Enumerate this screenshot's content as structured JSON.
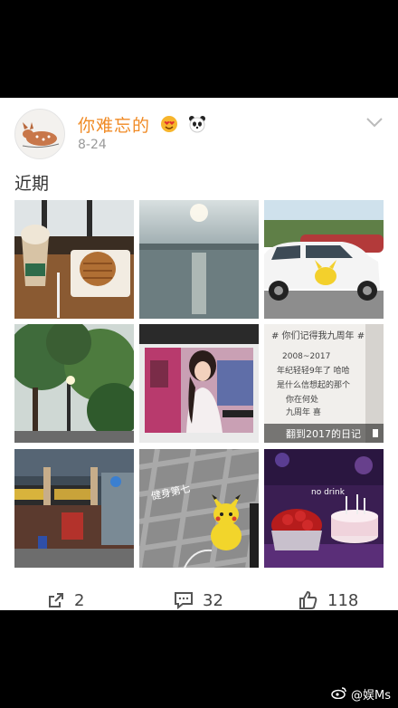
{
  "post": {
    "username": "你难忘的",
    "date": "8-24",
    "section_title": "近期"
  },
  "photos": [
    {
      "name": "photo-starbucks-cafe"
    },
    {
      "name": "photo-lake-sunset"
    },
    {
      "name": "photo-car-pikachu"
    },
    {
      "name": "photo-trees-streetlight"
    },
    {
      "name": "photo-girl-piano"
    },
    {
      "name": "photo-diary-page",
      "caption": "翻到2017的日记",
      "note_lines": [
        "# 你们记得我九周年 #",
        "2008~2017",
        "年纪轻轻9年了 哈哈",
        "是什么信想起的那个",
        "你在何处",
        "九周年 喜"
      ]
    },
    {
      "name": "photo-shopping-street"
    },
    {
      "name": "photo-pikachu-toy",
      "caption": "健身第七"
    },
    {
      "name": "photo-birthday-cake",
      "caption": "no drink"
    }
  ],
  "actions": {
    "share_count": "2",
    "comment_count": "32",
    "like_count": "118"
  },
  "watermark": "@娱Ms",
  "colors": {
    "username": "#f08a24",
    "background": "#000000"
  }
}
